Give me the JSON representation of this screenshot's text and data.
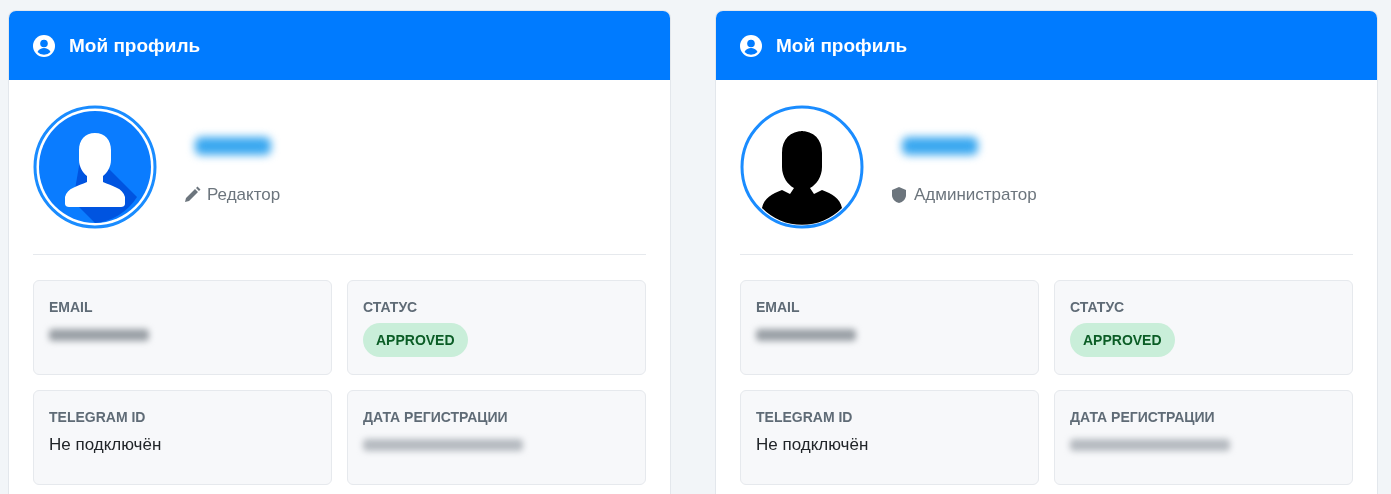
{
  "cards": [
    {
      "title": "Мой профиль",
      "avatar": {
        "kind": "flat"
      },
      "username": {
        "redacted": true
      },
      "role": {
        "kind": "editor",
        "label": "Редактор"
      },
      "fields": [
        {
          "label": "EMAIL",
          "kind": "text",
          "redacted": true
        },
        {
          "label": "СТАТУС",
          "kind": "badge",
          "value": "APPROVED"
        },
        {
          "label": "TELEGRAM ID",
          "kind": "text",
          "value": "Не подключён"
        },
        {
          "label": "ДАТА РЕГИСТРАЦИИ",
          "kind": "date",
          "redacted": true
        }
      ]
    },
    {
      "title": "Мой профиль",
      "avatar": {
        "kind": "silhouette"
      },
      "username": {
        "redacted": true
      },
      "role": {
        "kind": "admin",
        "label": "Администратор"
      },
      "fields": [
        {
          "label": "EMAIL",
          "kind": "text",
          "redacted": true
        },
        {
          "label": "СТАТУС",
          "kind": "badge",
          "value": "APPROVED"
        },
        {
          "label": "TELEGRAM ID",
          "kind": "text",
          "value": "Не подключён"
        },
        {
          "label": "ДАТА РЕГИСТРАЦИИ",
          "kind": "date",
          "redacted": true
        }
      ]
    }
  ]
}
